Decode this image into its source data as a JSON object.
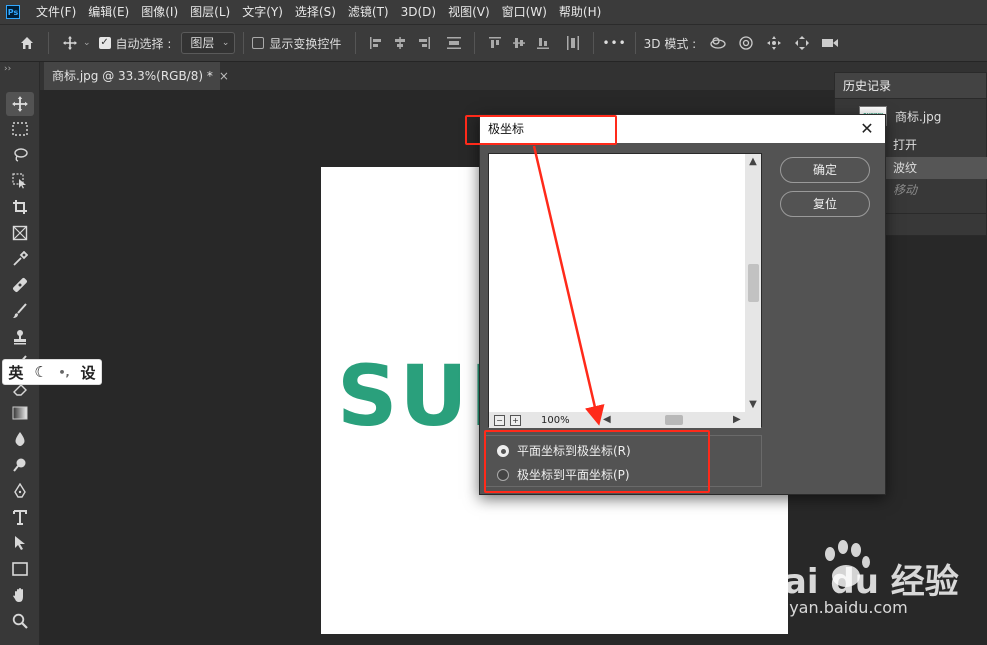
{
  "menu": [
    "文件(F)",
    "编辑(E)",
    "图像(I)",
    "图层(L)",
    "文字(Y)",
    "选择(S)",
    "滤镜(T)",
    "3D(D)",
    "视图(V)",
    "窗口(W)",
    "帮助(H)"
  ],
  "options": {
    "auto_select_label": "自动选择 :",
    "auto_select_value": "图层",
    "show_transform_label": "显示变换控件",
    "mode_3d_label": "3D 模式 :",
    "more": "•••"
  },
  "tab": {
    "title": "商标.jpg @ 33.3%(RGB/8) *",
    "close": "×"
  },
  "ime": {
    "lang": "英",
    "settings": "设"
  },
  "canvas": {
    "text": "SUNNY"
  },
  "history": {
    "title": "历史记录",
    "snapshot": "商标.jpg",
    "items": [
      "打开",
      "波纹",
      "移动"
    ]
  },
  "dialog": {
    "title": "极坐标",
    "close": "✕",
    "ok": "确定",
    "reset": "复位",
    "zoom": "100%",
    "zoom_out": "−",
    "zoom_in": "+",
    "options": [
      "平面坐标到极坐标(R)",
      "极坐标到平面坐标(P)"
    ],
    "selected_option": 0
  },
  "watermark": {
    "brand": "Bai du 经验",
    "url": "jingyan.baidu.com"
  },
  "colors": {
    "annotation": "#ff2a1a",
    "logo_text": "#2aa07c"
  }
}
